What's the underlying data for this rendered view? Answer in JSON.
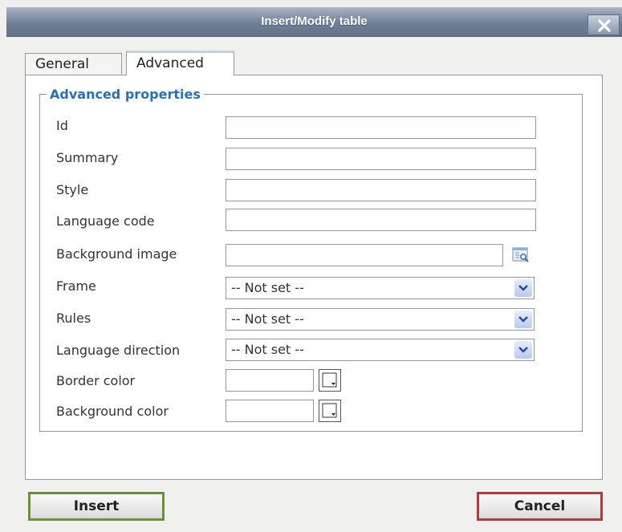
{
  "dialog": {
    "title": "Insert/Modify table",
    "close_label": "Close"
  },
  "tabs": [
    {
      "label": "General",
      "active": false
    },
    {
      "label": "Advanced",
      "active": true
    }
  ],
  "fieldset": {
    "legend": "Advanced properties"
  },
  "fields": {
    "id": {
      "label": "Id",
      "value": ""
    },
    "summary": {
      "label": "Summary",
      "value": ""
    },
    "style": {
      "label": "Style",
      "value": ""
    },
    "language_code": {
      "label": "Language code",
      "value": ""
    },
    "background_image": {
      "label": "Background image",
      "value": "",
      "browse_icon": "browse-icon"
    },
    "frame": {
      "label": "Frame",
      "selected": "-- Not set --"
    },
    "rules": {
      "label": "Rules",
      "selected": "-- Not set --"
    },
    "language_direction": {
      "label": "Language direction",
      "selected": "-- Not set --"
    },
    "border_color": {
      "label": "Border color",
      "value": "",
      "picker_icon": "color-picker-icon"
    },
    "background_color": {
      "label": "Background color",
      "value": "",
      "picker_icon": "color-picker-icon"
    }
  },
  "buttons": {
    "insert": "Insert",
    "cancel": "Cancel"
  },
  "colors": {
    "titlebar": "#6f7f96",
    "legend": "#2b6fb6",
    "insert_border": "#6c8f36",
    "cancel_border": "#b3393a"
  }
}
